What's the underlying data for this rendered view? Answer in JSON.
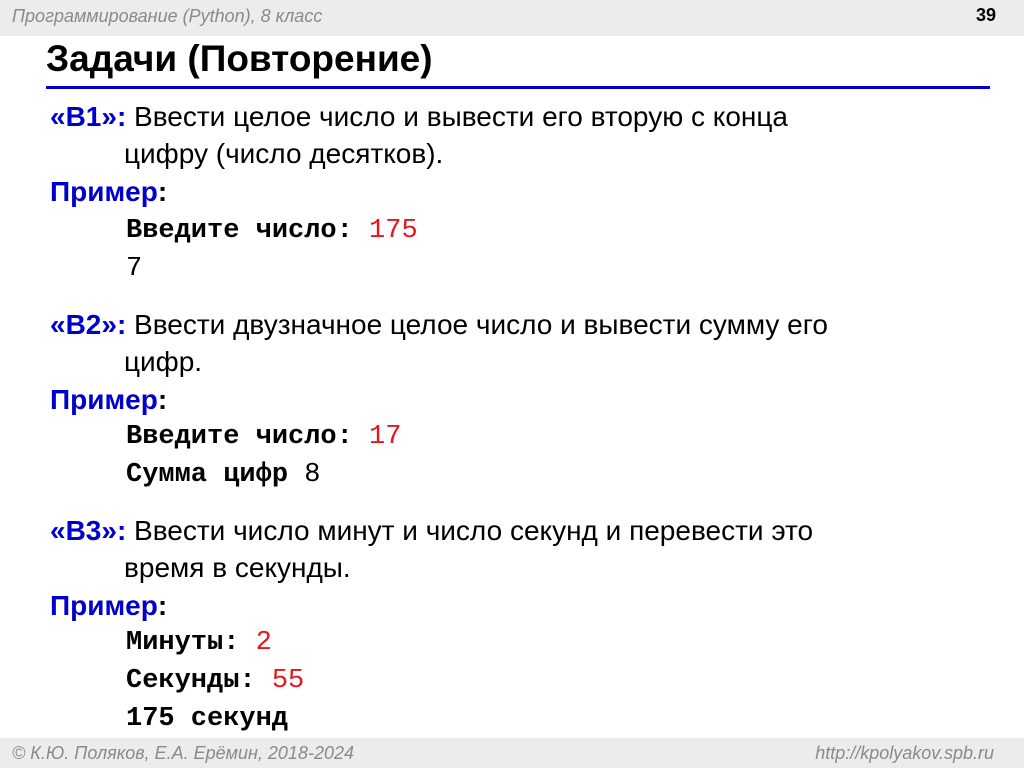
{
  "header": {
    "course": "Программирование (Python), 8 класс",
    "page_number": "39"
  },
  "title": "Задачи (Повторение)",
  "example_label": "Пример",
  "example_colon": ":",
  "tasks": [
    {
      "label": "«B1»:",
      "text_line1": " Ввести целое число и вывести его вторую с конца",
      "text_line2": "цифру (число десятков).",
      "code": [
        {
          "prompt": "Введите число: ",
          "input": "175"
        },
        {
          "output": "7"
        }
      ]
    },
    {
      "label": "«B2»:",
      "text_line1": " Ввести двузначное целое число и вывести сумму его",
      "text_line2": "цифр.",
      "code": [
        {
          "prompt": "Введите число: ",
          "input": "17"
        },
        {
          "prompt": "Сумма цифр ",
          "output": "8"
        }
      ]
    },
    {
      "label": "«B3»:",
      "text_line1": " Ввести число минут и число секунд и перевести это",
      "text_line2": "время в секунды.",
      "code": [
        {
          "prompt": "Минуты: ",
          "input": "2"
        },
        {
          "prompt": "Секунды: ",
          "input": "55"
        },
        {
          "prompt": "175 секунд"
        }
      ]
    }
  ],
  "footer": {
    "author": "© К.Ю. Поляков, Е.А. Ерёмин, 2018-2024",
    "site": "http://kpolyakov.spb.ru"
  },
  "colors": {
    "accent_blue": "#0000cc",
    "input_red": "#e8141a",
    "bar_gray": "#ececec"
  }
}
